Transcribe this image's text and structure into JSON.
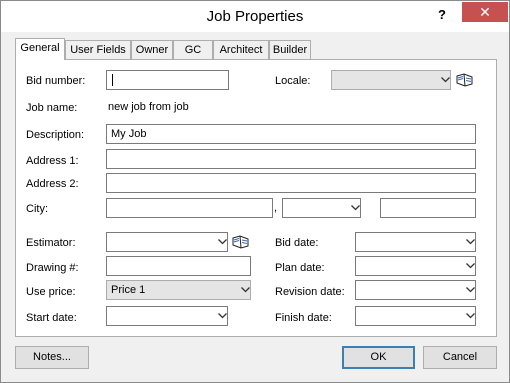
{
  "window": {
    "title": "Job Properties",
    "help": "?",
    "close": "✕"
  },
  "tabs": [
    "General",
    "User Fields",
    "Owner",
    "GC",
    "Architect",
    "Builder"
  ],
  "fields": {
    "bid_number": {
      "label": "Bid number:",
      "value": ""
    },
    "locale": {
      "label": "Locale:",
      "value": ""
    },
    "job_name": {
      "label": "Job name:",
      "value": "new job from job"
    },
    "description": {
      "label": "Description:",
      "value": "My Job"
    },
    "address1": {
      "label": "Address 1:",
      "value": ""
    },
    "address2": {
      "label": "Address 2:",
      "value": ""
    },
    "city": {
      "label": "City:",
      "value": "",
      "state": "",
      "zip": "",
      "separator": ","
    },
    "estimator": {
      "label": "Estimator:",
      "value": ""
    },
    "bid_date": {
      "label": "Bid date:",
      "value": ""
    },
    "drawing": {
      "label": "Drawing #:",
      "value": ""
    },
    "plan_date": {
      "label": "Plan date:",
      "value": ""
    },
    "use_price": {
      "label": "Use price:",
      "value": "Price 1"
    },
    "revision_date": {
      "label": "Revision date:",
      "value": ""
    },
    "start_date": {
      "label": "Start date:",
      "value": ""
    },
    "finish_date": {
      "label": "Finish date:",
      "value": ""
    }
  },
  "buttons": {
    "notes": "Notes...",
    "ok": "OK",
    "cancel": "Cancel"
  },
  "icons": {
    "lookup": "book-lookup-icon",
    "dropdown": "chevron-down-icon"
  },
  "colors": {
    "close": "#c75050",
    "default_button_border": "#3c7fb1"
  }
}
